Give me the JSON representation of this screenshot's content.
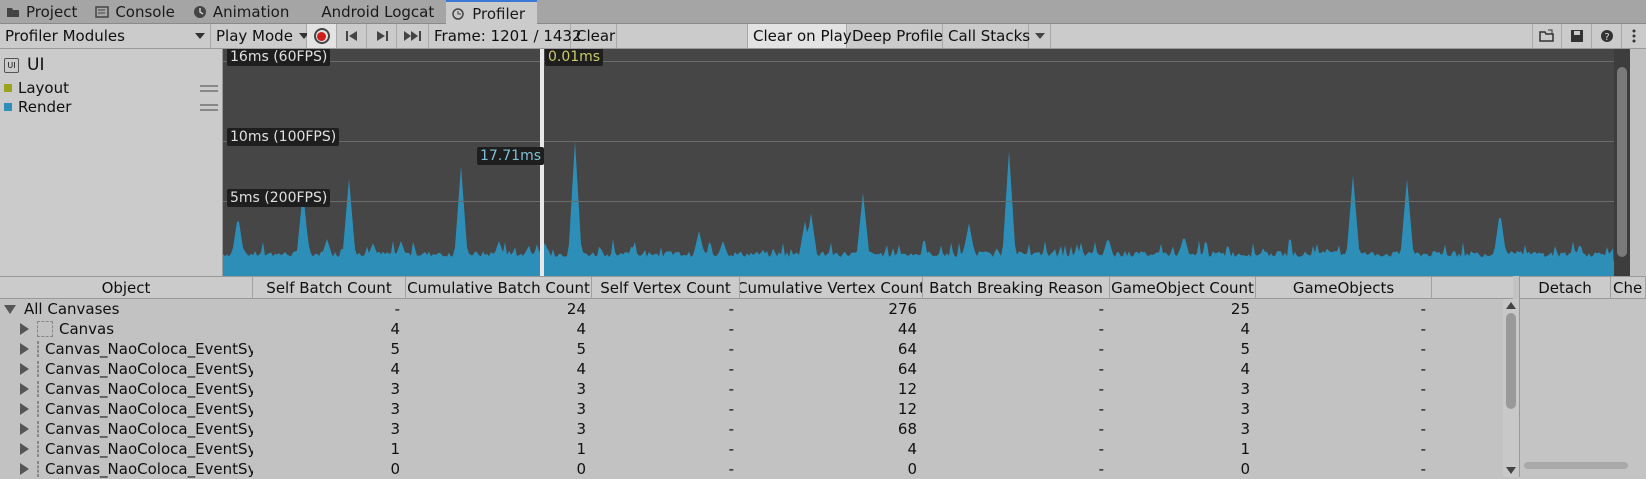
{
  "tabs": [
    {
      "label": "Project",
      "icon": "folder-icon"
    },
    {
      "label": "Console",
      "icon": "console-icon"
    },
    {
      "label": "Animation",
      "icon": "animation-icon"
    },
    {
      "label": "Android Logcat",
      "icon": ""
    },
    {
      "label": "Profiler",
      "icon": "profiler-icon",
      "active": true
    }
  ],
  "toolbar": {
    "modules": "Profiler Modules",
    "mode": "Play Mode",
    "frame": "Frame: 1201 / 1432",
    "clear": "Clear",
    "clear_on_play": "Clear on Play",
    "deep_profile": "Deep Profile",
    "call_stacks": "Call Stacks"
  },
  "module": {
    "title": "UI",
    "legend": [
      {
        "label": "Layout",
        "color": "#9aa21e"
      },
      {
        "label": "Render",
        "color": "#2d8fb8"
      }
    ]
  },
  "graph": {
    "lines": [
      {
        "label": "16ms (60FPS)"
      },
      {
        "label": "10ms (100FPS)"
      },
      {
        "label": "5ms (200FPS)"
      }
    ],
    "selected_value": "0.01ms",
    "hover_value": "17.71ms",
    "fill_color": "#2d8fb8"
  },
  "table": {
    "headers": [
      "Object",
      "Self Batch Count",
      "Cumulative Batch Count",
      "Self Vertex Count",
      "Cumulative Vertex Count",
      "Batch Breaking Reason",
      "GameObject Count",
      "GameObjects"
    ],
    "rows": [
      {
        "name": "All Canvases",
        "self_batch": "-",
        "cum_batch": "24",
        "self_vertex": "-",
        "cum_vertex": "276",
        "reason": "-",
        "go_count": "25",
        "gos": "-"
      },
      {
        "name": "Canvas",
        "self_batch": "4",
        "cum_batch": "4",
        "self_vertex": "-",
        "cum_vertex": "44",
        "reason": "-",
        "go_count": "4",
        "gos": "-"
      },
      {
        "name": "Canvas_NaoColoca_EventSy",
        "self_batch": "5",
        "cum_batch": "5",
        "self_vertex": "-",
        "cum_vertex": "64",
        "reason": "-",
        "go_count": "5",
        "gos": "-"
      },
      {
        "name": "Canvas_NaoColoca_EventSy",
        "self_batch": "4",
        "cum_batch": "4",
        "self_vertex": "-",
        "cum_vertex": "64",
        "reason": "-",
        "go_count": "4",
        "gos": "-"
      },
      {
        "name": "Canvas_NaoColoca_EventSy",
        "self_batch": "3",
        "cum_batch": "3",
        "self_vertex": "-",
        "cum_vertex": "12",
        "reason": "-",
        "go_count": "3",
        "gos": "-"
      },
      {
        "name": "Canvas_NaoColoca_EventSy",
        "self_batch": "3",
        "cum_batch": "3",
        "self_vertex": "-",
        "cum_vertex": "12",
        "reason": "-",
        "go_count": "3",
        "gos": "-"
      },
      {
        "name": "Canvas_NaoColoca_EventSy",
        "self_batch": "3",
        "cum_batch": "3",
        "self_vertex": "-",
        "cum_vertex": "68",
        "reason": "-",
        "go_count": "3",
        "gos": "-"
      },
      {
        "name": "Canvas_NaoColoca_EventSy",
        "self_batch": "1",
        "cum_batch": "1",
        "self_vertex": "-",
        "cum_vertex": "4",
        "reason": "-",
        "go_count": "1",
        "gos": "-"
      },
      {
        "name": "Canvas_NaoColoca_EventSy",
        "self_batch": "0",
        "cum_batch": "0",
        "self_vertex": "-",
        "cum_vertex": "0",
        "reason": "-",
        "go_count": "0",
        "gos": "-"
      }
    ]
  },
  "detach": {
    "label": "Detach",
    "next_label": "Che"
  }
}
